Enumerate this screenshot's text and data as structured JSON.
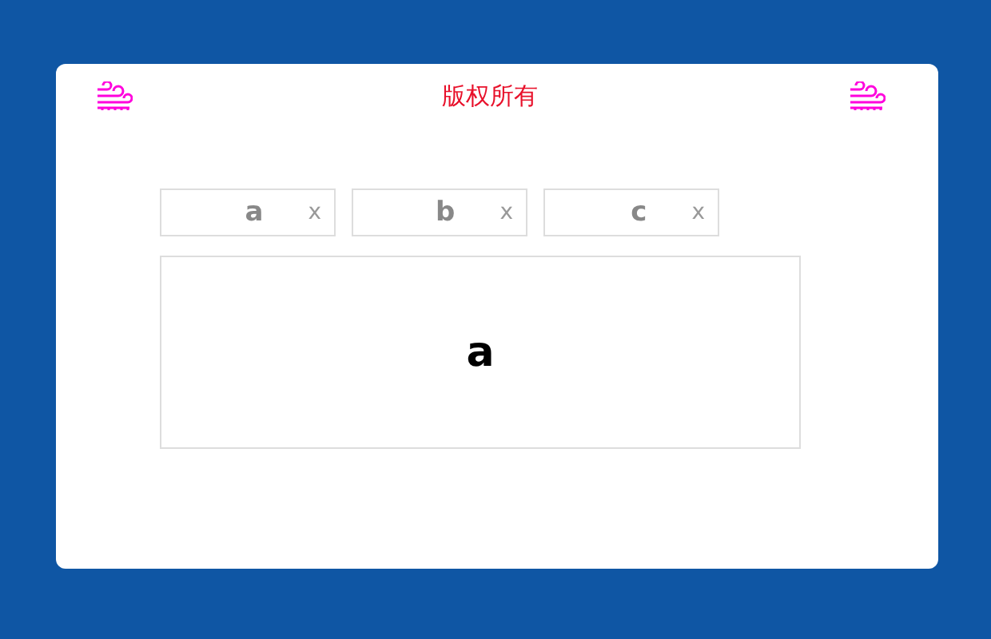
{
  "header": {
    "title": "版权所有"
  },
  "tabs": [
    {
      "label": "a",
      "close": "x"
    },
    {
      "label": "b",
      "close": "x"
    },
    {
      "label": "c",
      "close": "x"
    }
  ],
  "panel": {
    "content": "a"
  }
}
